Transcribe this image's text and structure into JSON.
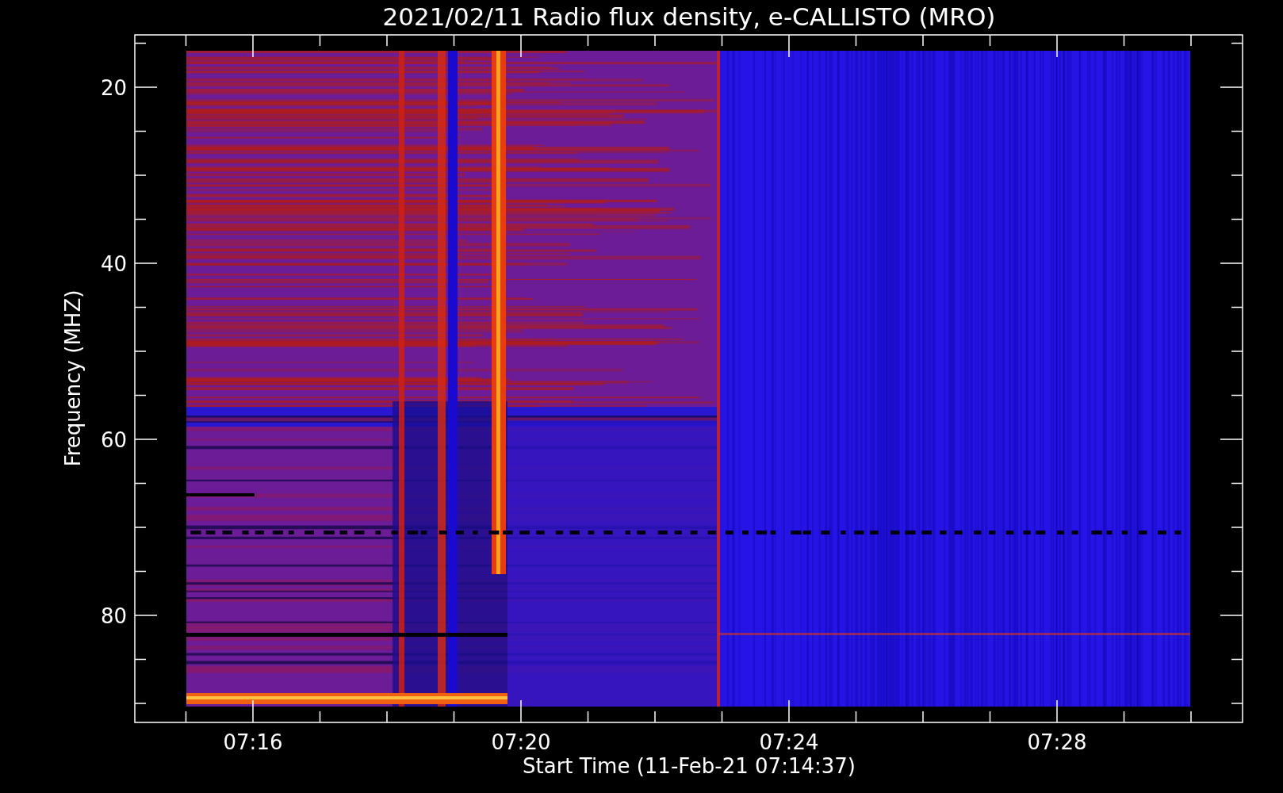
{
  "title": "2021/02/11  Radio flux density, e-CALLISTO (MRO)",
  "y_axis": {
    "label": "Frequency (MHZ)",
    "ticks": [
      "20",
      "40",
      "60",
      "80"
    ]
  },
  "x_axis": {
    "label": "Start Time (11-Feb-21 07:14:37)",
    "ticks": [
      "07:16",
      "07:20",
      "07:24",
      "07:28"
    ]
  }
}
